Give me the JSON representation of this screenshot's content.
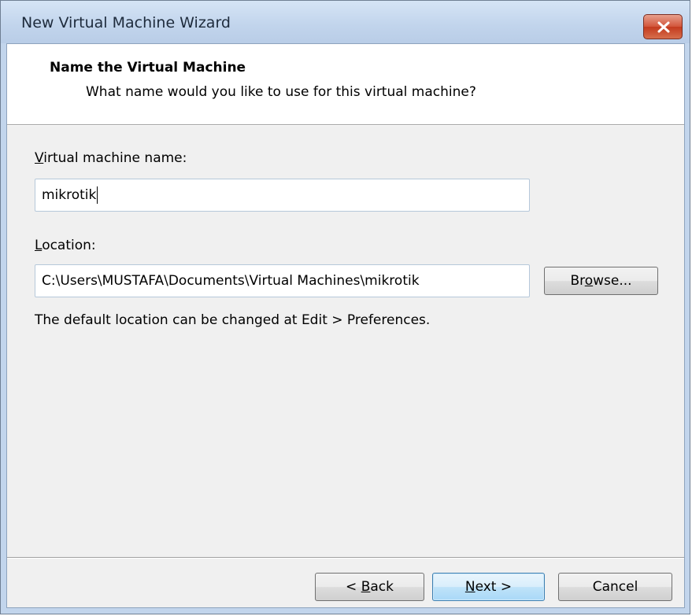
{
  "window": {
    "title": "New Virtual Machine Wizard"
  },
  "header": {
    "title": "Name the Virtual Machine",
    "subtitle": "What name would you like to use for this virtual machine?"
  },
  "form": {
    "vm_name": {
      "label_mnemonic": "V",
      "label_rest": "irtual machine name:",
      "value": "mikrotik"
    },
    "location": {
      "label_mnemonic": "L",
      "label_rest": "ocation:",
      "value": "C:\\Users\\MUSTAFA\\Documents\\Virtual Machines\\mikrotik"
    },
    "browse_button": {
      "pre": "Br",
      "mnemonic": "o",
      "post": "wse..."
    },
    "hint": "The default location can be changed at Edit > Preferences."
  },
  "footer": {
    "back_button": {
      "pre": "< ",
      "mnemonic": "B",
      "post": "ack"
    },
    "next_button": {
      "pre": "",
      "mnemonic": "N",
      "post": "ext >"
    },
    "cancel_label": "Cancel"
  },
  "icons": {
    "close": "close-icon"
  }
}
